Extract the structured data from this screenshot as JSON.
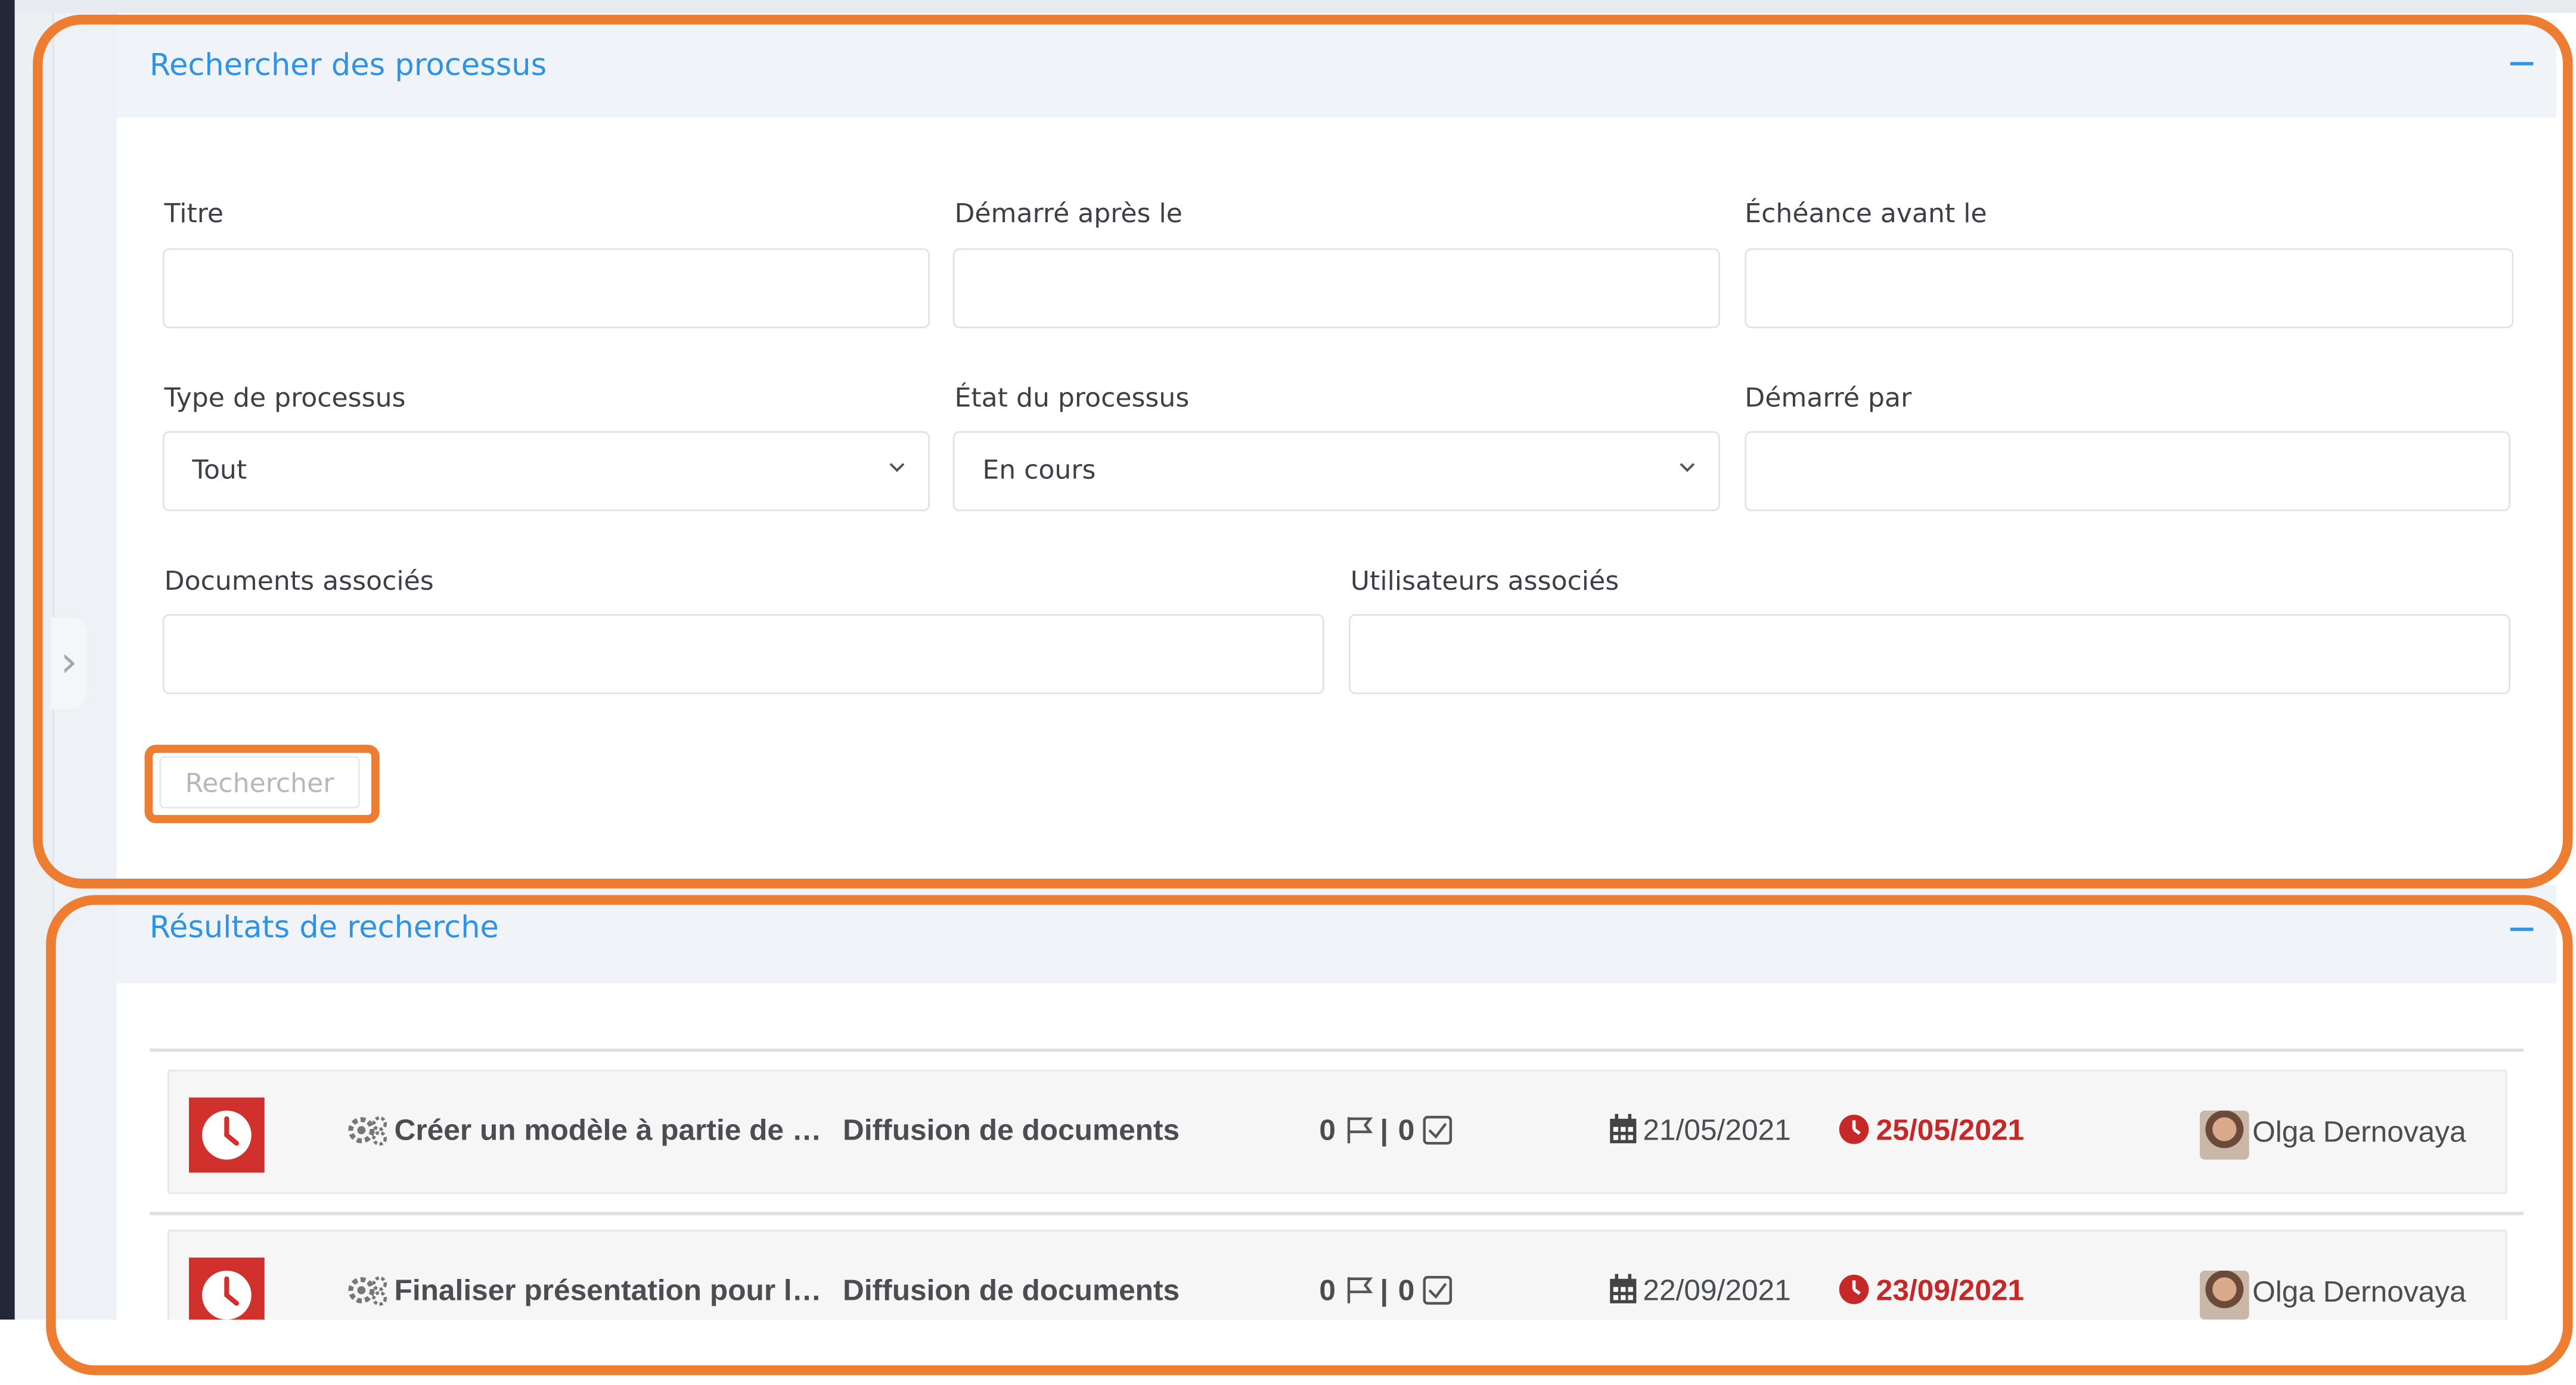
{
  "search_panel": {
    "title": "Rechercher des processus",
    "labels": {
      "title": "Titre",
      "started_after": "Démarré après le",
      "due_before": "Échéance avant le",
      "process_type": "Type de processus",
      "process_state": "État du processus",
      "started_by": "Démarré par",
      "documents": "Documents associés",
      "users": "Utilisateurs associés"
    },
    "values": {
      "title": "",
      "started_after": "",
      "due_before": "",
      "process_type": "Tout",
      "process_state": "En cours",
      "started_by": "",
      "documents": "",
      "users": ""
    },
    "search_button": "Rechercher"
  },
  "results_panel": {
    "title": "Résultats de recherche",
    "rows": [
      {
        "status_icon": "clock-icon",
        "name": "Créer un modèle à partie de …",
        "type": "Diffusion de documents",
        "flags": "0",
        "separator": "|",
        "tasks": "0",
        "start_date": "21/05/2021",
        "due_date": "25/05/2021",
        "owner": "Olga Dernovaya"
      },
      {
        "status_icon": "clock-icon",
        "name": "Finaliser présentation pour l…",
        "type": "Diffusion de documents",
        "flags": "0",
        "separator": "|",
        "tasks": "0",
        "start_date": "22/09/2021",
        "due_date": "23/09/2021",
        "owner": "Olga Dernovaya"
      }
    ]
  },
  "colors": {
    "accent": "#2f93e4",
    "highlight": "#ed7d31",
    "overdue": "#c62828",
    "status_tile": "#d0312d"
  }
}
